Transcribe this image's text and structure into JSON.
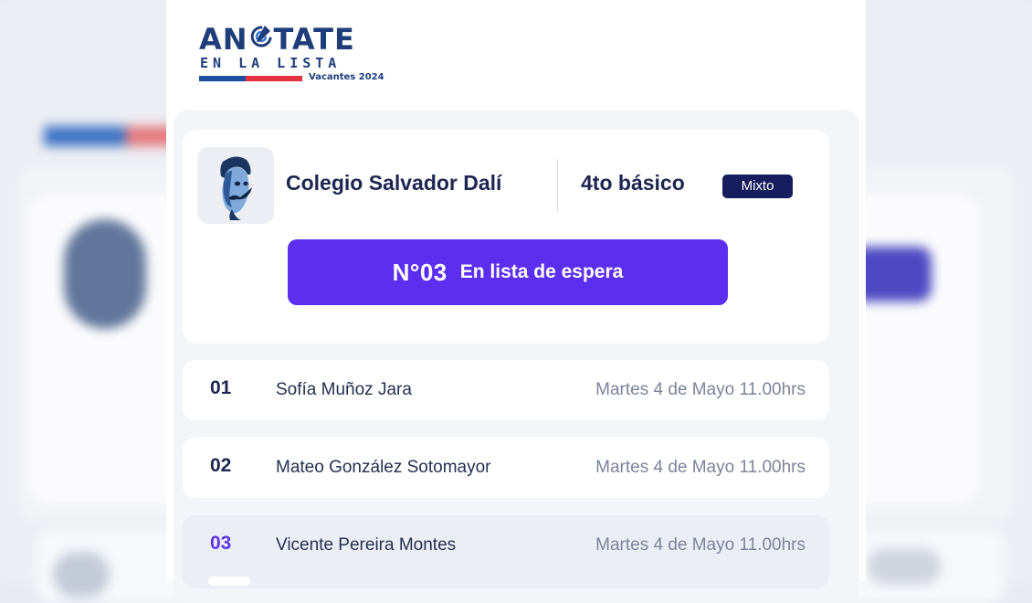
{
  "app": {
    "logo": {
      "main_prefix": "AN",
      "main_suffix": "TATE",
      "sub": "EN LA LISTA",
      "tagline": "Vacantes 2024"
    }
  },
  "school": {
    "name": "Colegio Salvador Dalí",
    "grade": "4to básico",
    "type": "Mixto"
  },
  "status": {
    "position": "N°03",
    "label": "En lista de espera"
  },
  "queue": [
    {
      "number": "01",
      "name": "Sofía Muñoz Jara",
      "date": "Martes 4 de Mayo 11.00hrs",
      "current": false
    },
    {
      "number": "02",
      "name": "Mateo González Sotomayor",
      "date": "Martes 4 de Mayo 11.00hrs",
      "current": false
    },
    {
      "number": "03",
      "name": "Vicente Pereira Montes",
      "date": "Martes 4 de Mayo 11.00hrs",
      "current": true
    }
  ],
  "colors": {
    "brand_navy": "#1d2550",
    "status_purple": "#5b2ef0",
    "current_number": "#5b34e6",
    "flag_blue": "#1f4da0",
    "flag_red": "#e2333d"
  }
}
